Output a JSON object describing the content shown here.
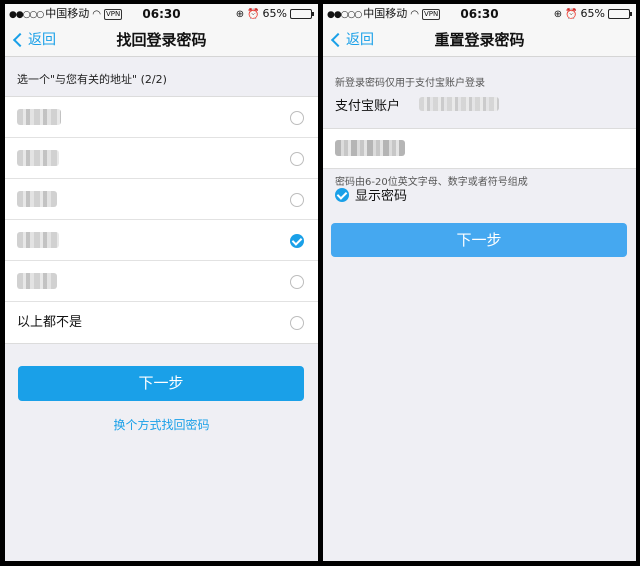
{
  "status_bar": {
    "carrier": "中国移动",
    "vpn": "VPN",
    "time": "06:30",
    "battery_text": "65%",
    "battery_level": 0.65
  },
  "left_screen": {
    "nav": {
      "back_label": "返回",
      "title": "找回登录密码"
    },
    "question": "选一个\"与您有关的地址\" (2/2)",
    "options": [
      {
        "label": "",
        "blurred": true,
        "checked": false
      },
      {
        "label": "",
        "blurred": true,
        "checked": false
      },
      {
        "label": "",
        "blurred": true,
        "checked": false
      },
      {
        "label": "",
        "blurred": true,
        "checked": true
      },
      {
        "label": "",
        "blurred": true,
        "checked": false
      },
      {
        "label": "以上都不是",
        "blurred": false,
        "checked": false
      }
    ],
    "next_label": "下一步",
    "alt_link": "换个方式找回密码"
  },
  "right_screen": {
    "nav": {
      "back_label": "返回",
      "title": "重置登录密码"
    },
    "hint_account": "新登录密码仅用于支付宝账户登录",
    "account_label": "支付宝账户",
    "hint_password": "密码由6-20位英文字母、数字或者符号组成",
    "show_password_label": "显示密码",
    "show_password_checked": true,
    "next_label": "下一步"
  },
  "colors": {
    "accent": "#1aa0e8",
    "background": "#efeff4"
  }
}
